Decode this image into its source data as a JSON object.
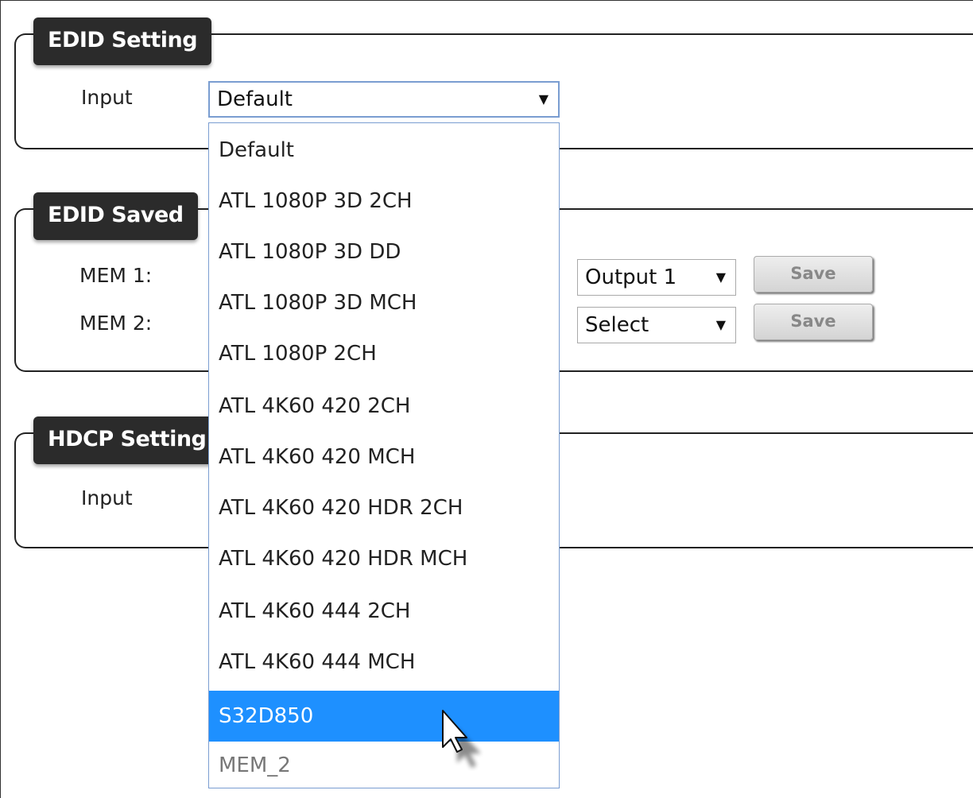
{
  "edid_setting": {
    "title": "EDID Setting",
    "input_label": "Input",
    "input_selected": "Default"
  },
  "edid_saved": {
    "title": "EDID Saved",
    "mem1_label": "MEM 1:",
    "mem2_label": "MEM 2:",
    "mem1_output": "Output 1",
    "mem2_output": "Select",
    "save_label": "Save"
  },
  "hdcp_setting": {
    "title": "HDCP Setting",
    "input_label": "Input"
  },
  "dropdown": {
    "options": [
      "Default",
      "ATL 1080P 3D 2CH",
      "ATL 1080P 3D DD",
      "ATL 1080P 3D MCH",
      "ATL 1080P 2CH",
      "ATL 4K60 420 2CH",
      "ATL 4K60 420 MCH",
      "ATL 4K60 420 HDR 2CH",
      "ATL 4K60 420 HDR MCH",
      "ATL 4K60 444 2CH",
      "ATL 4K60 444 MCH",
      "S32D850",
      "MEM_2"
    ],
    "highlighted": "S32D850",
    "highlight_color": "#1e90ff"
  },
  "icons": {
    "select_arrow": "triangle-down-icon",
    "cursor": "mouse-pointer-icon"
  }
}
